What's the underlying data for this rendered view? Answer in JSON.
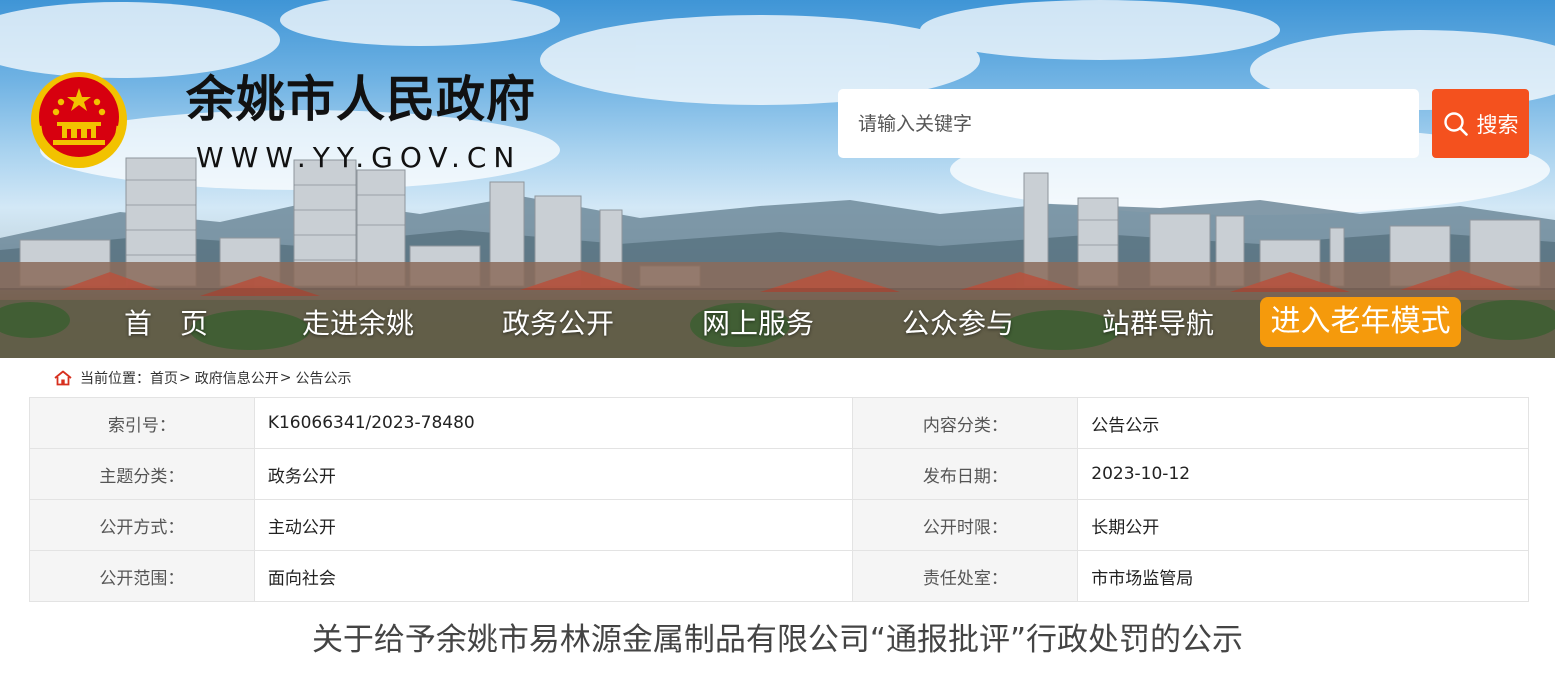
{
  "header": {
    "site_title": "余姚市人民政府",
    "site_url": "WWW.YY.GOV.CN",
    "search": {
      "placeholder": "请输入关键字",
      "button_label": "搜索",
      "icon": "search-icon"
    }
  },
  "nav": {
    "items": [
      {
        "label": "首　页"
      },
      {
        "label": "走进余姚"
      },
      {
        "label": "政务公开"
      },
      {
        "label": "网上服务"
      },
      {
        "label": "公众参与"
      },
      {
        "label": "站群导航"
      }
    ],
    "elder_mode_label": "进入老年模式"
  },
  "breadcrumb": {
    "prefix": "当前位置：",
    "items": [
      "首页",
      "政府信息公开",
      "公告公示"
    ],
    "separator": ">",
    "icon": "home-icon"
  },
  "meta": {
    "rows": [
      {
        "label1": "索引号：",
        "value1": "K16066341/2023-78480",
        "label2": "内容分类：",
        "value2": "公告公示"
      },
      {
        "label1": "主题分类：",
        "value1": "政务公开",
        "label2": "发布日期：",
        "value2": "2023-10-12"
      },
      {
        "label1": "公开方式：",
        "value1": "主动公开",
        "label2": "公开时限：",
        "value2": "长期公开"
      },
      {
        "label1": "公开范围：",
        "value1": "面向社会",
        "label2": "责任处室：",
        "value2": "市市场监管局"
      }
    ]
  },
  "article": {
    "title": "关于给予余姚市易林源金属制品有限公司“通报批评”行政处罚的公示"
  },
  "colors": {
    "search_button": "#f4511e",
    "elder_button": "#f59a0c",
    "label_cell_bg": "#f5f5f5",
    "border": "#e3e3e3",
    "emblem_red": "#d7000f",
    "emblem_gold": "#f2c200"
  }
}
